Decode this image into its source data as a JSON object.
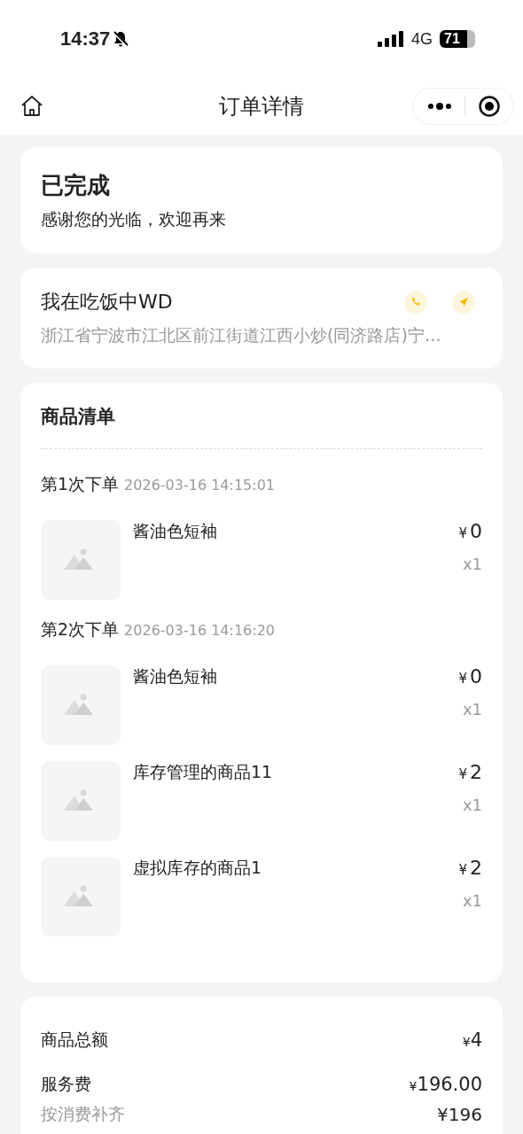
{
  "status_bar": {
    "time": "14:37",
    "network": "4G",
    "battery": "71",
    "muted": true
  },
  "nav": {
    "title": "订单详情"
  },
  "order_status": {
    "title": "已完成",
    "message": "感谢您的光临，欢迎再来"
  },
  "store": {
    "name": "我在吃饭中WD",
    "address": "浙江省宁波市江北区前江街道江西小炒(同济路店)宁…"
  },
  "goods": {
    "title": "商品清单",
    "batches": [
      {
        "label": "第1次下单",
        "time": "2026-03-16 14:15:01",
        "items": [
          {
            "name": "酱油色短袖",
            "currency": "¥",
            "amount": "0",
            "qty": "x1"
          }
        ]
      },
      {
        "label": "第2次下单",
        "time": "2026-03-16 14:16:20",
        "items": [
          {
            "name": "酱油色短袖",
            "currency": "¥",
            "amount": "0",
            "qty": "x1"
          },
          {
            "name": "库存管理的商品11",
            "currency": "¥",
            "amount": "2",
            "qty": "x1"
          },
          {
            "name": "虚拟库存的商品1",
            "currency": "¥",
            "amount": "2",
            "qty": "x1"
          }
        ]
      }
    ]
  },
  "summary": [
    {
      "kind": "main",
      "label": "商品总额",
      "currency": "¥",
      "amount": "4"
    },
    {
      "kind": "main",
      "label": "服务费",
      "currency": "¥",
      "amount": "196.00"
    },
    {
      "kind": "sub",
      "label": "按消费补齐",
      "value": "¥196"
    }
  ]
}
